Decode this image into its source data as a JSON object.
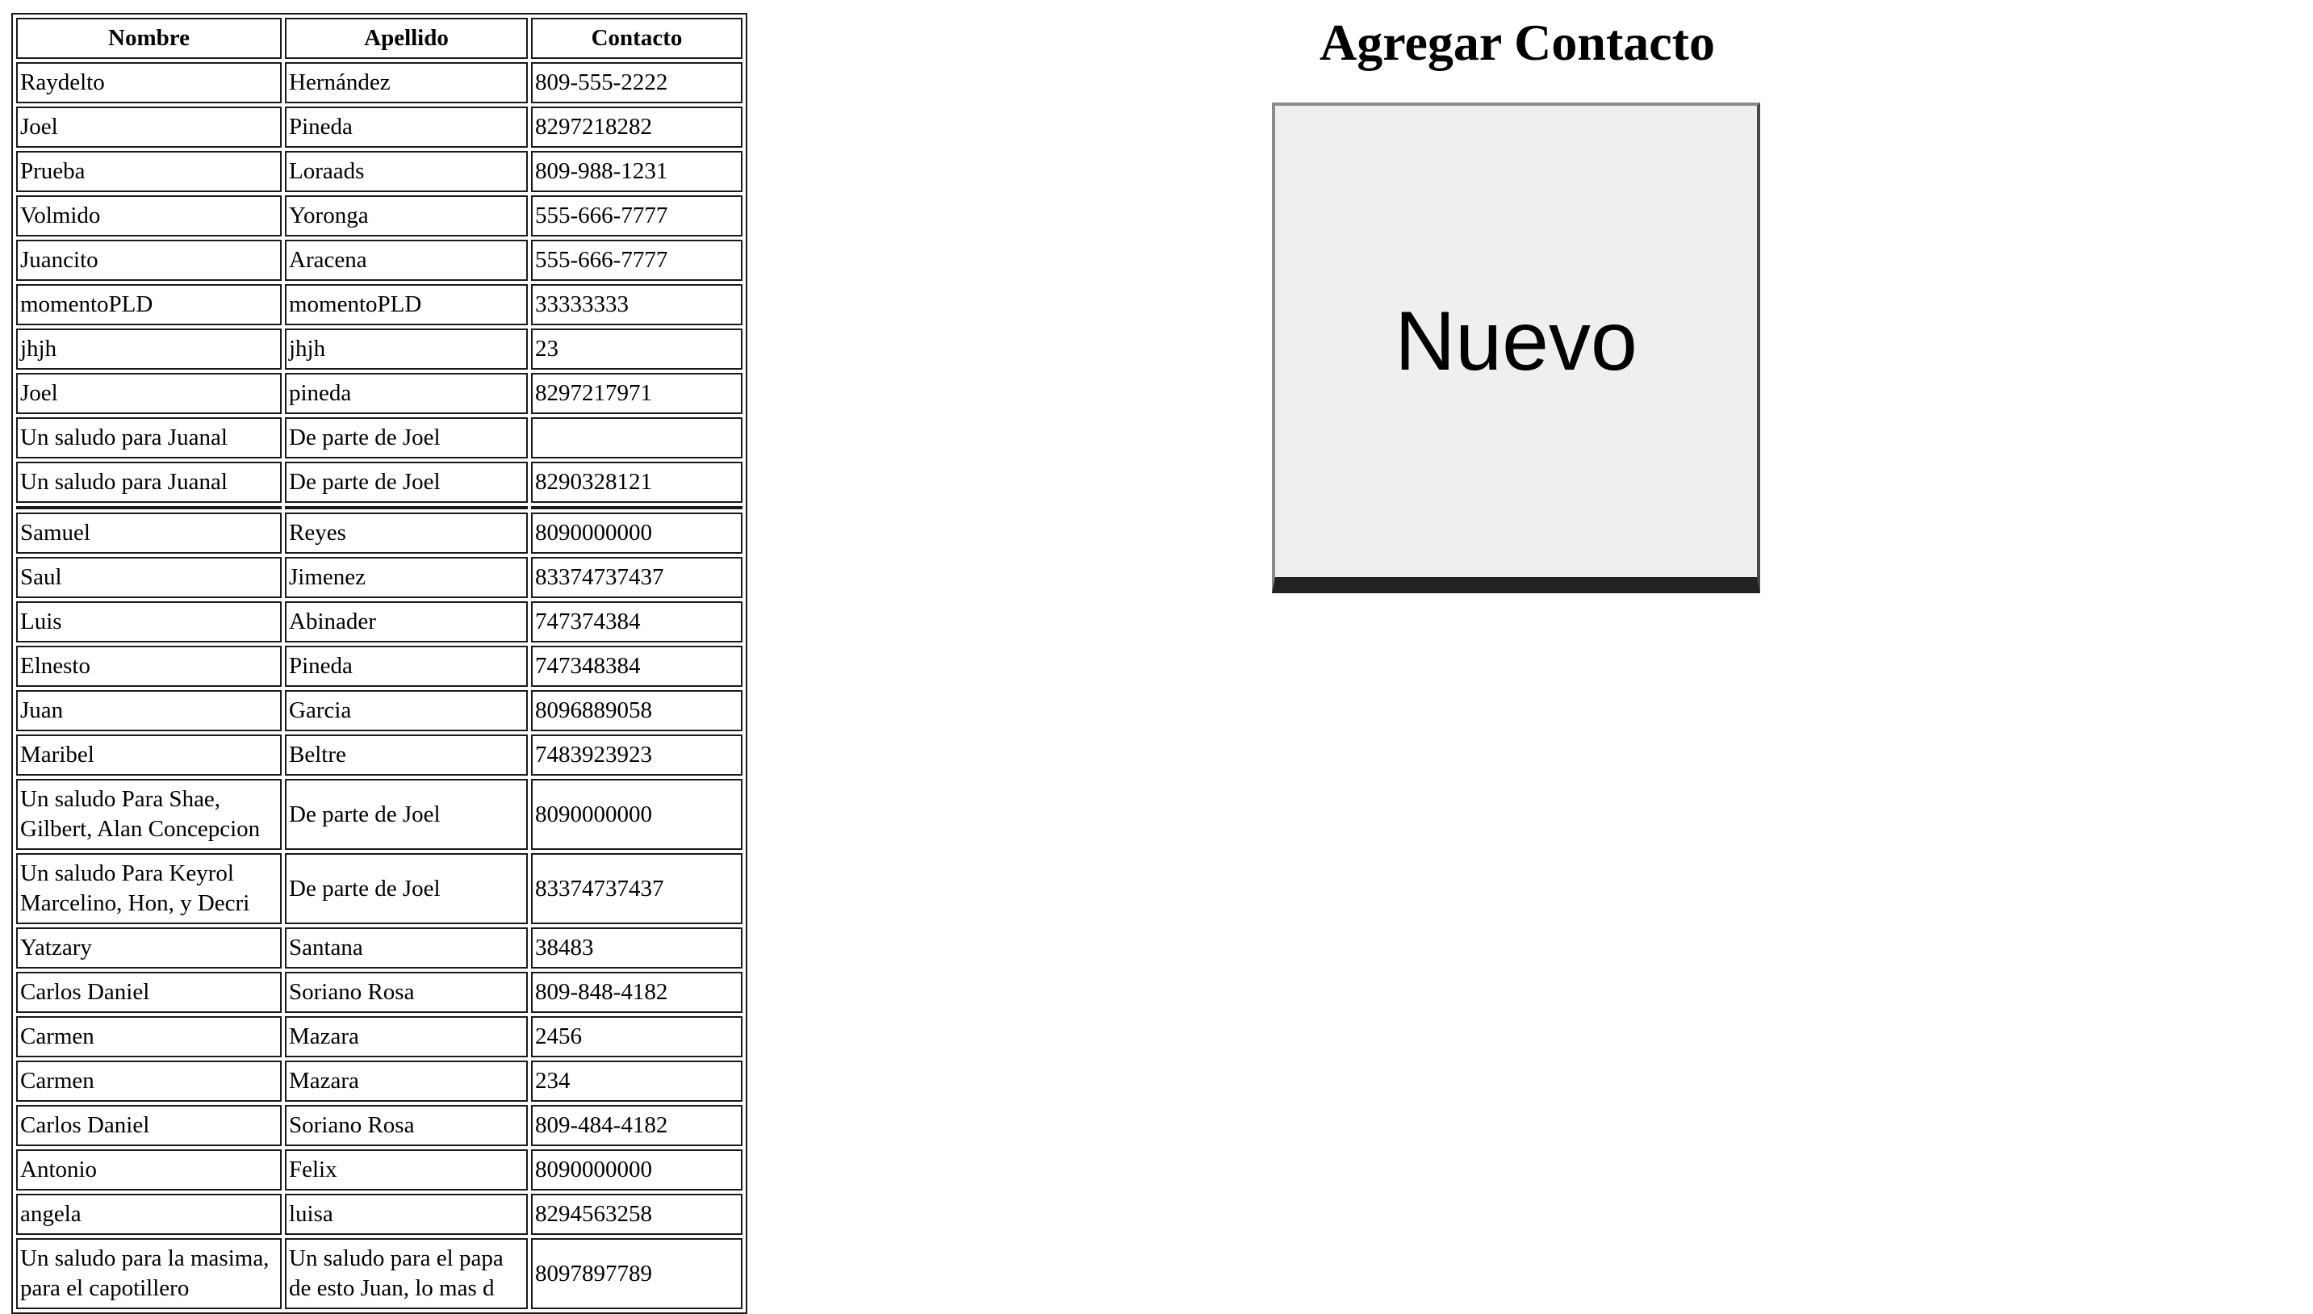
{
  "table": {
    "headers": [
      "Nombre",
      "Apellido",
      "Contacto"
    ],
    "rows": [
      [
        "Raydelto",
        "Hernández",
        "809-555-2222"
      ],
      [
        "Joel",
        "Pineda",
        "8297218282"
      ],
      [
        "Prueba",
        "Loraads",
        "809-988-1231"
      ],
      [
        "Volmido",
        "Yoronga",
        "555-666-7777"
      ],
      [
        "Juancito",
        "Aracena",
        "555-666-7777"
      ],
      [
        "momentoPLD",
        "momentoPLD",
        "33333333"
      ],
      [
        "jhjh",
        "jhjh",
        "23"
      ],
      [
        "Joel",
        "pineda",
        "8297217971"
      ],
      [
        "Un saludo para Juanal",
        "De parte de Joel",
        ""
      ],
      [
        "Un saludo para Juanal",
        "De parte de Joel",
        "8290328121"
      ],
      [
        "",
        "",
        ""
      ],
      [
        "Samuel",
        "Reyes",
        "8090000000"
      ],
      [
        "Saul",
        "Jimenez",
        "83374737437"
      ],
      [
        "Luis",
        "Abinader",
        "747374384"
      ],
      [
        "Elnesto",
        "Pineda",
        "747348384"
      ],
      [
        "Juan",
        "Garcia",
        "8096889058"
      ],
      [
        "Maribel",
        "Beltre",
        "7483923923"
      ],
      [
        "Un saludo Para Shae, Gilbert, Alan Concepcion",
        "De parte de Joel",
        "8090000000"
      ],
      [
        "Un saludo Para Keyrol Marcelino, Hon, y Decri",
        "De parte de Joel",
        "83374737437"
      ],
      [
        "Yatzary",
        "Santana",
        "38483"
      ],
      [
        "Carlos Daniel",
        "Soriano Rosa",
        "809-848-4182"
      ],
      [
        "Carmen",
        "Mazara",
        "2456"
      ],
      [
        "Carmen",
        "Mazara",
        "234"
      ],
      [
        "Carlos Daniel",
        "Soriano Rosa",
        "809-484-4182"
      ],
      [
        "Antonio",
        "Felix",
        "8090000000"
      ],
      [
        "angela",
        "luisa",
        "8294563258"
      ],
      [
        "Un saludo para la masima, para el capotillero",
        "Un saludo para el papa de esto Juan, lo mas d",
        "8097897789"
      ]
    ]
  },
  "form": {
    "title": "Agregar Contacto",
    "new_button_label": "Nuevo"
  }
}
